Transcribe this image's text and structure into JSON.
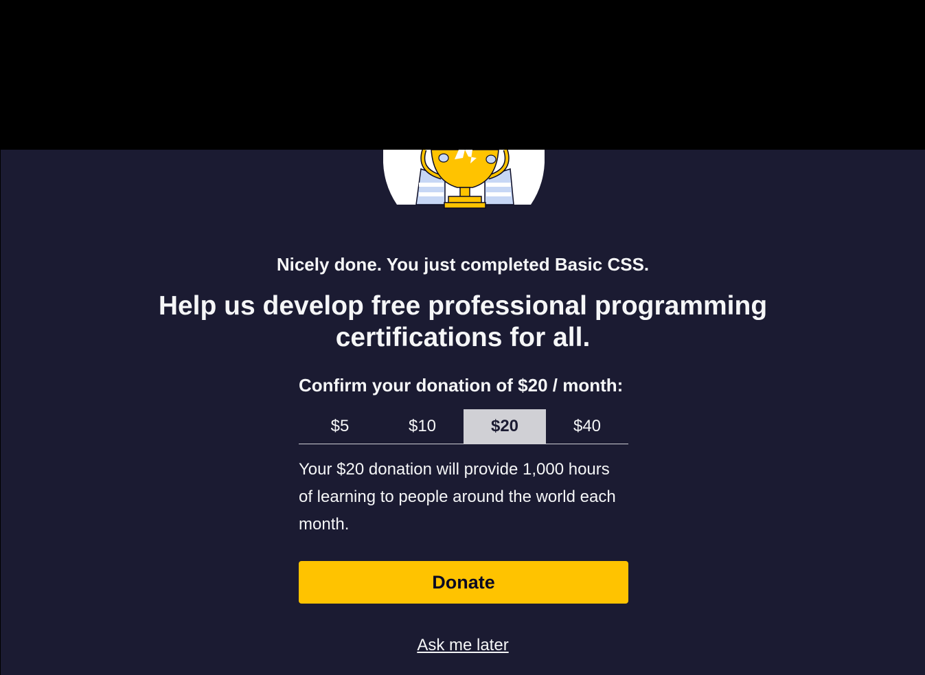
{
  "modal": {
    "illustration_icon": "trophy-illustration",
    "subtitle": "Nicely done. You just completed Basic CSS.",
    "headline": "Help us develop free professional programming certifications for all.",
    "confirm_text": "Confirm your donation of $20 / month:",
    "tabs": [
      {
        "label": "$5",
        "selected": false
      },
      {
        "label": "$10",
        "selected": false
      },
      {
        "label": "$20",
        "selected": true
      },
      {
        "label": "$40",
        "selected": false
      }
    ],
    "description": "Your $20 donation will provide 1,000 hours of learning to people around the world each month.",
    "donate_label": "Donate",
    "later_label": "Ask me later"
  },
  "colors": {
    "background": "#1b1b32",
    "accent": "#ffc300",
    "tab_active": "#d0d0d5",
    "text": "#f5f6f7"
  }
}
